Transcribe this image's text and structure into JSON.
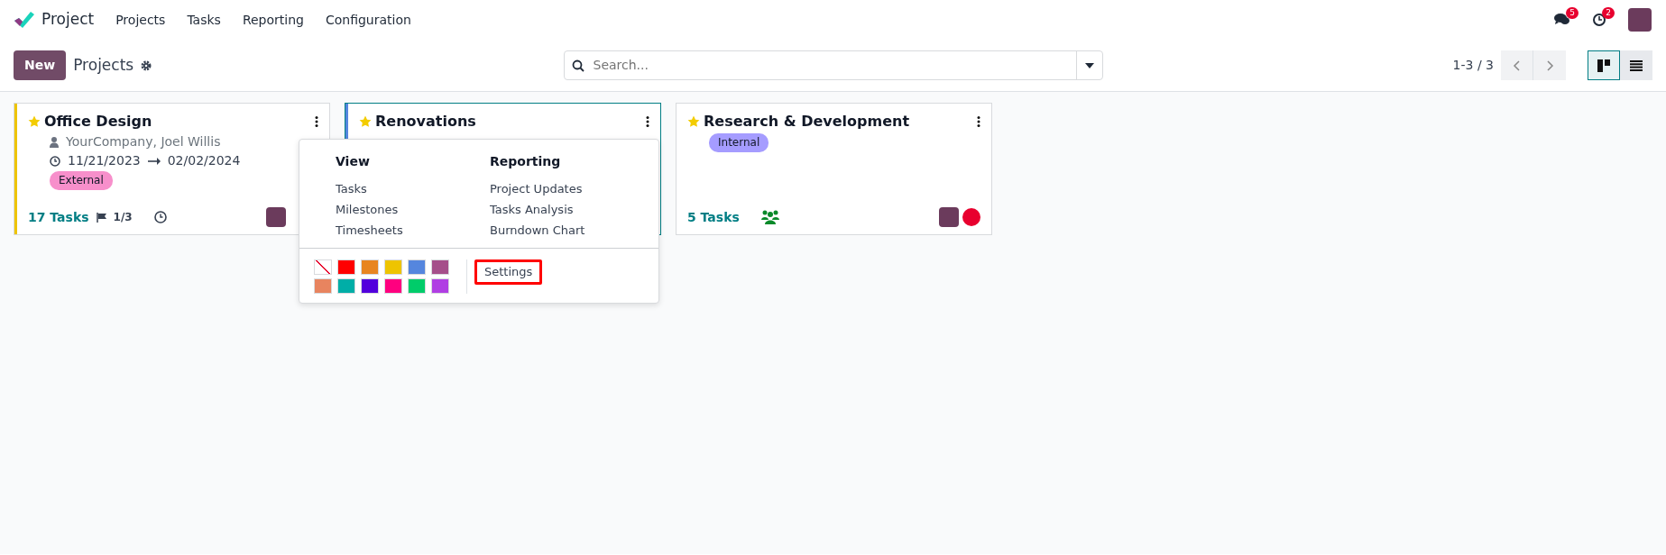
{
  "navbar": {
    "app_name": "Project",
    "menu": [
      "Projects",
      "Tasks",
      "Reporting",
      "Configuration"
    ],
    "notifications": [
      {
        "kind": "messages",
        "count": "5"
      },
      {
        "kind": "activities",
        "count": "2"
      }
    ]
  },
  "control_panel": {
    "new_button": "New",
    "breadcrumb": "Projects",
    "search": {
      "placeholder": "Search..."
    },
    "pager": "1-3 / 3",
    "views": [
      {
        "kind": "kanban",
        "selected": true
      },
      {
        "kind": "list",
        "selected": false
      }
    ]
  },
  "projects": [
    {
      "name": "Office Design",
      "favorite": true,
      "color": "#eec400",
      "focused": false,
      "customer": "YourCompany, Joel Willis",
      "date_start": "11/21/2023",
      "date_end": "02/02/2024",
      "tag": {
        "label": "External",
        "color": "#f78fcb"
      },
      "tasks": "17 Tasks",
      "milestones": "1/3",
      "activity": true,
      "team": false,
      "avatar": true
    },
    {
      "name": "Renovations",
      "favorite": true,
      "color": "#5586de",
      "focused": true
    },
    {
      "name": "Research & Development",
      "favorite": true,
      "focused": false,
      "tag": {
        "label": "Internal",
        "color": "#a59cff"
      },
      "tasks": "5 Tasks",
      "activity": false,
      "team": true,
      "avatar": true,
      "status": {
        "color": "#e8002e"
      }
    }
  ],
  "dropdown": {
    "sections": [
      {
        "heading": "View",
        "items": [
          "Tasks",
          "Milestones",
          "Timesheets"
        ]
      },
      {
        "heading": "Reporting",
        "items": [
          "Project Updates",
          "Tasks Analysis",
          "Burndown Chart"
        ]
      }
    ],
    "colors": [
      {
        "kind": "none"
      },
      {
        "kind": "swatch",
        "color": "#ff0000"
      },
      {
        "kind": "swatch",
        "color": "#e8851f"
      },
      {
        "kind": "swatch",
        "color": "#eec400"
      },
      {
        "kind": "swatch",
        "color": "#5586de"
      },
      {
        "kind": "swatch",
        "color": "#a54f8a"
      },
      {
        "kind": "swatch",
        "color": "#e8845f"
      },
      {
        "kind": "swatch",
        "color": "#00aea7"
      },
      {
        "kind": "swatch",
        "color": "#5200dc"
      },
      {
        "kind": "swatch",
        "color": "#ff007f"
      },
      {
        "kind": "swatch",
        "color": "#00cc6a"
      },
      {
        "kind": "swatch",
        "color": "#b03ee3"
      }
    ],
    "settings": {
      "label": "Settings",
      "highlighted": true
    }
  }
}
